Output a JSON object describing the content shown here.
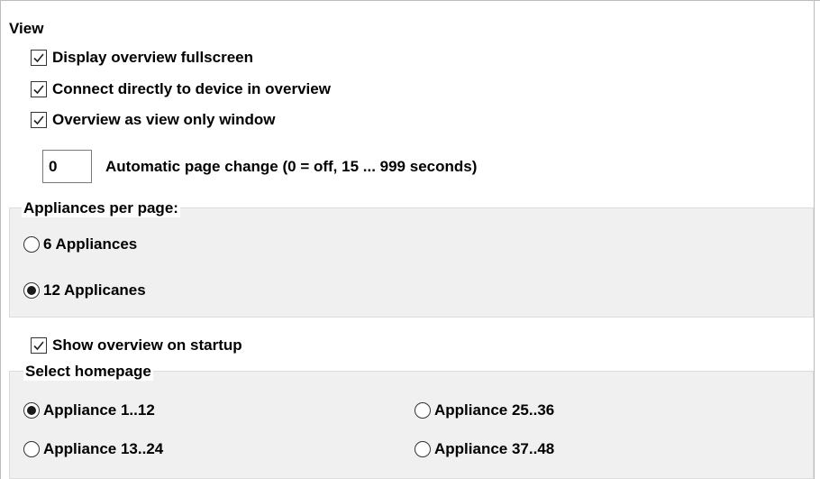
{
  "view": {
    "title": "View",
    "checkboxes": [
      {
        "label": "Display overview fullscreen",
        "checked": true
      },
      {
        "label": "Connect directly to device in overview",
        "checked": true
      },
      {
        "label": "Overview as view only window",
        "checked": true
      }
    ],
    "auto_page_change": {
      "value": "0",
      "label": "Automatic page change (0 = off, 15 ... 999 seconds)"
    }
  },
  "appliances_per_page": {
    "title": "Appliances per page:",
    "options": [
      {
        "label": "6 Appliances",
        "selected": false
      },
      {
        "label": "12 Applicanes",
        "selected": true
      }
    ]
  },
  "startup": {
    "label": "Show overview on startup",
    "checked": true
  },
  "homepage": {
    "title": "Select homepage",
    "options": [
      {
        "label": "Appliance 1..12",
        "selected": true
      },
      {
        "label": "Appliance 25..36",
        "selected": false
      },
      {
        "label": "Appliance 13..24",
        "selected": false
      },
      {
        "label": "Appliance 37..48",
        "selected": false
      }
    ]
  },
  "colors": {
    "background": "#ffffff",
    "group_background": "#f0f0f0",
    "border": "#bcbcbc",
    "text": "#000000"
  }
}
